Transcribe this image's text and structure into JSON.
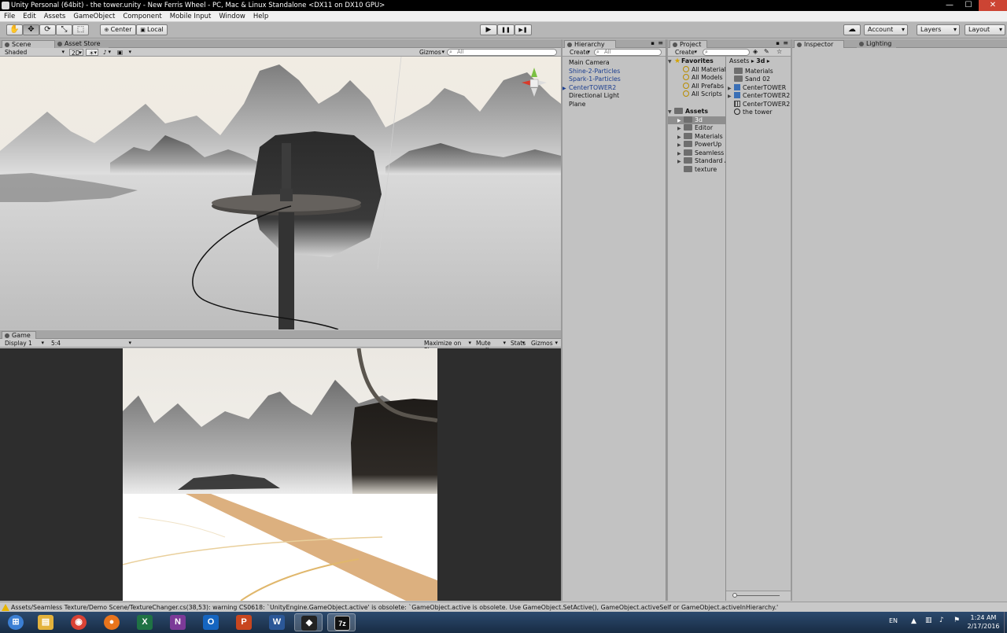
{
  "window": {
    "title": "Unity Personal (64bit) - the tower.unity - New Ferris Wheel - PC, Mac & Linux Standalone <DX11 on DX10 GPU>",
    "minimize_glyph": "—",
    "maximize_glyph": "☐",
    "close_glyph": "✕"
  },
  "menu": [
    "File",
    "Edit",
    "Assets",
    "GameObject",
    "Component",
    "Mobile Input",
    "Window",
    "Help"
  ],
  "toolbar": {
    "tools": [
      {
        "name": "hand-tool",
        "glyph": "✋"
      },
      {
        "name": "move-tool",
        "glyph": "✥"
      },
      {
        "name": "rotate-tool",
        "glyph": "⟳"
      },
      {
        "name": "scale-tool",
        "glyph": "⤡"
      },
      {
        "name": "rect-tool",
        "glyph": "⬚"
      }
    ],
    "pivot_label": "Center",
    "space_label": "Local",
    "play_glyph": "▶",
    "pause_glyph": "❚❚",
    "step_glyph": "▶❚",
    "cloud_glyph": "☁",
    "account_label": "Account",
    "layers_label": "Layers",
    "layout_label": "Layout"
  },
  "scene": {
    "tabs": [
      "Scene",
      "Asset Store"
    ],
    "shading_mode": "Shaded",
    "mode_2d": "2D",
    "light_glyph": "☀",
    "audio_glyph": "♪",
    "fx_glyph": "▣",
    "gizmos_label": "Gizmos",
    "search_placeholder": "All"
  },
  "game": {
    "tab": "Game",
    "display": "Display 1",
    "aspect": "5:4",
    "maximize_on_play": "Maximize on Play",
    "mute_audio": "Mute audio",
    "stats": "Stats",
    "gizmos": "Gizmos"
  },
  "hierarchy": {
    "tab": "Hierarchy",
    "create_label": "Create",
    "search_placeholder": "All",
    "items": [
      {
        "label": "Main Camera",
        "blue": false,
        "arrow": ""
      },
      {
        "label": "Shine-2-Particles",
        "blue": true,
        "arrow": ""
      },
      {
        "label": "Spark-1-Particles",
        "blue": true,
        "arrow": ""
      },
      {
        "label": "CenterTOWER2",
        "blue": true,
        "arrow": "▶"
      },
      {
        "label": "Directional Light",
        "blue": false,
        "arrow": ""
      },
      {
        "label": "Plane",
        "blue": false,
        "arrow": ""
      }
    ]
  },
  "project": {
    "tab": "Project",
    "create_label": "Create",
    "favorites_label": "Favorites",
    "favorites": [
      "All Material",
      "All Models",
      "All Prefabs",
      "All Scripts"
    ],
    "assets_label": "Assets",
    "folders": [
      "3d",
      "Editor",
      "Materials",
      "PowerUp",
      "Seamless T",
      "Standard A",
      "texture"
    ],
    "breadcrumb_root": "Assets",
    "breadcrumb_sep": "▸",
    "breadcrumb_current": "3d",
    "files": [
      {
        "label": "Materials",
        "icon": "folder"
      },
      {
        "label": "Sand 02",
        "icon": "folder"
      },
      {
        "label": "CenterTOWER",
        "icon": "prefab"
      },
      {
        "label": "CenterTOWER2",
        "icon": "prefab"
      },
      {
        "label": "CenterTOWER2",
        "icon": "mesh"
      },
      {
        "label": "the tower",
        "icon": "unity-scene"
      }
    ]
  },
  "inspector": {
    "tabs": [
      "Inspector",
      "Lighting"
    ]
  },
  "status": {
    "message": "Assets/Seamless Texture/Demo Scene/TextureChanger.cs(38,53): warning CS0618: `UnityEngine.GameObject.active' is obsolete: `GameObject.active is obsolete. Use GameObject.SetActive(), GameObject.activeSelf or GameObject.activeInHierarchy.'"
  },
  "taskbar": {
    "apps": [
      {
        "name": "start-button",
        "glyph": "⊞",
        "color": "#3b7fd4"
      },
      {
        "name": "file-explorer",
        "glyph": "▤",
        "color": "#e3b23c"
      },
      {
        "name": "chrome",
        "glyph": "◉",
        "color": "#d94235"
      },
      {
        "name": "firefox",
        "glyph": "●",
        "color": "#e8741c"
      },
      {
        "name": "excel",
        "glyph": "X",
        "color": "#1f7244"
      },
      {
        "name": "onenote",
        "glyph": "N",
        "color": "#7c3a98"
      },
      {
        "name": "outlook",
        "glyph": "O",
        "color": "#1565c0"
      },
      {
        "name": "powerpoint",
        "glyph": "P",
        "color": "#c8461f"
      },
      {
        "name": "word",
        "glyph": "W",
        "color": "#2b5797"
      },
      {
        "name": "unity",
        "glyph": "◆",
        "color": "#222222"
      },
      {
        "name": "7zip",
        "glyph": "7z",
        "color": "#111111"
      }
    ],
    "language": "EN",
    "time": "1:24 AM",
    "date": "2/17/2016"
  }
}
